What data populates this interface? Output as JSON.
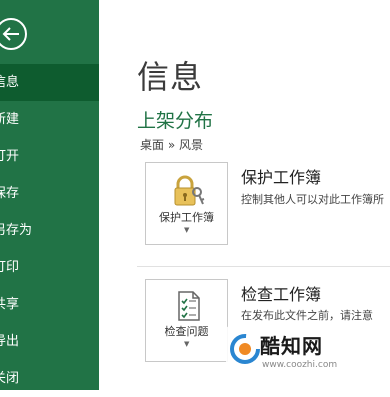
{
  "sidebar": {
    "back_label": "←",
    "items": [
      {
        "label": "信息",
        "active": true
      },
      {
        "label": "新建"
      },
      {
        "label": "打开"
      },
      {
        "label": "保存"
      },
      {
        "label": "另存为"
      },
      {
        "label": "打印"
      },
      {
        "label": "共享"
      },
      {
        "label": "导出"
      },
      {
        "label": "关闭"
      }
    ],
    "color": "#217346",
    "active_color": "#0e5c2f"
  },
  "main": {
    "page_title": "信息",
    "doc_title": "上架分布",
    "breadcrumb": "桌面 » 风景",
    "protect": {
      "button_label": "保护工作簿",
      "icon": "lock-key-icon",
      "title": "保护工作簿",
      "desc": "控制其他人可以对此工作簿所"
    },
    "inspect": {
      "button_label": "检查问题",
      "icon": "checklist-icon",
      "title": "检查工作簿",
      "desc": "在发布此文件之前，请注意"
    }
  },
  "watermark": {
    "name": "酷知网",
    "url": "www.coozhi.com"
  }
}
